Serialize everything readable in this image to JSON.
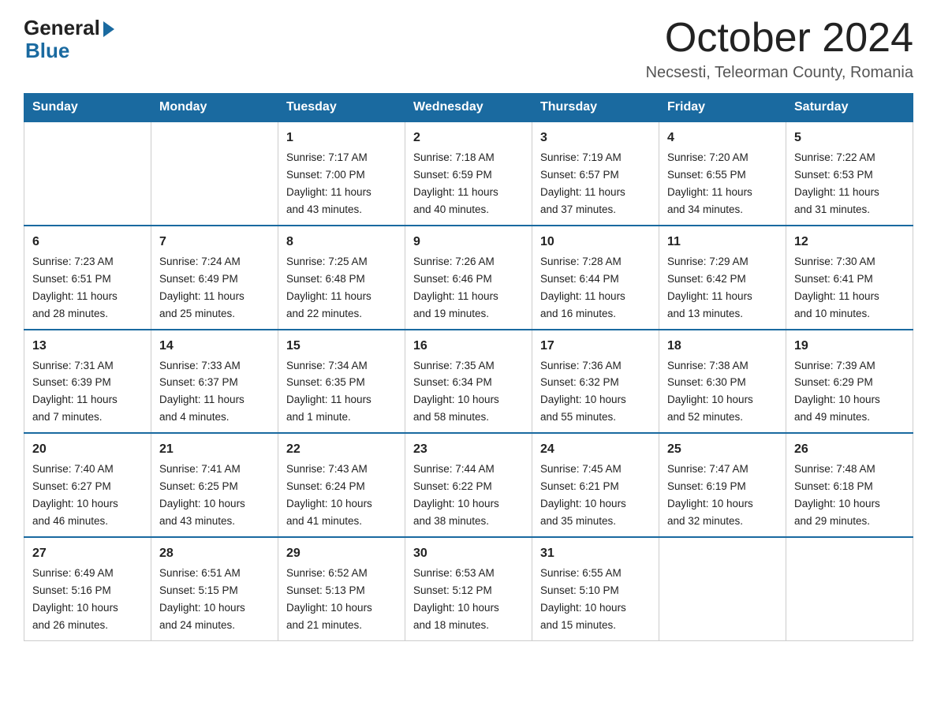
{
  "logo": {
    "general": "General",
    "blue": "Blue"
  },
  "title": "October 2024",
  "subtitle": "Necsesti, Teleorman County, Romania",
  "days_header": [
    "Sunday",
    "Monday",
    "Tuesday",
    "Wednesday",
    "Thursday",
    "Friday",
    "Saturday"
  ],
  "weeks": [
    [
      {
        "day": "",
        "info": ""
      },
      {
        "day": "",
        "info": ""
      },
      {
        "day": "1",
        "info": "Sunrise: 7:17 AM\nSunset: 7:00 PM\nDaylight: 11 hours\nand 43 minutes."
      },
      {
        "day": "2",
        "info": "Sunrise: 7:18 AM\nSunset: 6:59 PM\nDaylight: 11 hours\nand 40 minutes."
      },
      {
        "day": "3",
        "info": "Sunrise: 7:19 AM\nSunset: 6:57 PM\nDaylight: 11 hours\nand 37 minutes."
      },
      {
        "day": "4",
        "info": "Sunrise: 7:20 AM\nSunset: 6:55 PM\nDaylight: 11 hours\nand 34 minutes."
      },
      {
        "day": "5",
        "info": "Sunrise: 7:22 AM\nSunset: 6:53 PM\nDaylight: 11 hours\nand 31 minutes."
      }
    ],
    [
      {
        "day": "6",
        "info": "Sunrise: 7:23 AM\nSunset: 6:51 PM\nDaylight: 11 hours\nand 28 minutes."
      },
      {
        "day": "7",
        "info": "Sunrise: 7:24 AM\nSunset: 6:49 PM\nDaylight: 11 hours\nand 25 minutes."
      },
      {
        "day": "8",
        "info": "Sunrise: 7:25 AM\nSunset: 6:48 PM\nDaylight: 11 hours\nand 22 minutes."
      },
      {
        "day": "9",
        "info": "Sunrise: 7:26 AM\nSunset: 6:46 PM\nDaylight: 11 hours\nand 19 minutes."
      },
      {
        "day": "10",
        "info": "Sunrise: 7:28 AM\nSunset: 6:44 PM\nDaylight: 11 hours\nand 16 minutes."
      },
      {
        "day": "11",
        "info": "Sunrise: 7:29 AM\nSunset: 6:42 PM\nDaylight: 11 hours\nand 13 minutes."
      },
      {
        "day": "12",
        "info": "Sunrise: 7:30 AM\nSunset: 6:41 PM\nDaylight: 11 hours\nand 10 minutes."
      }
    ],
    [
      {
        "day": "13",
        "info": "Sunrise: 7:31 AM\nSunset: 6:39 PM\nDaylight: 11 hours\nand 7 minutes."
      },
      {
        "day": "14",
        "info": "Sunrise: 7:33 AM\nSunset: 6:37 PM\nDaylight: 11 hours\nand 4 minutes."
      },
      {
        "day": "15",
        "info": "Sunrise: 7:34 AM\nSunset: 6:35 PM\nDaylight: 11 hours\nand 1 minute."
      },
      {
        "day": "16",
        "info": "Sunrise: 7:35 AM\nSunset: 6:34 PM\nDaylight: 10 hours\nand 58 minutes."
      },
      {
        "day": "17",
        "info": "Sunrise: 7:36 AM\nSunset: 6:32 PM\nDaylight: 10 hours\nand 55 minutes."
      },
      {
        "day": "18",
        "info": "Sunrise: 7:38 AM\nSunset: 6:30 PM\nDaylight: 10 hours\nand 52 minutes."
      },
      {
        "day": "19",
        "info": "Sunrise: 7:39 AM\nSunset: 6:29 PM\nDaylight: 10 hours\nand 49 minutes."
      }
    ],
    [
      {
        "day": "20",
        "info": "Sunrise: 7:40 AM\nSunset: 6:27 PM\nDaylight: 10 hours\nand 46 minutes."
      },
      {
        "day": "21",
        "info": "Sunrise: 7:41 AM\nSunset: 6:25 PM\nDaylight: 10 hours\nand 43 minutes."
      },
      {
        "day": "22",
        "info": "Sunrise: 7:43 AM\nSunset: 6:24 PM\nDaylight: 10 hours\nand 41 minutes."
      },
      {
        "day": "23",
        "info": "Sunrise: 7:44 AM\nSunset: 6:22 PM\nDaylight: 10 hours\nand 38 minutes."
      },
      {
        "day": "24",
        "info": "Sunrise: 7:45 AM\nSunset: 6:21 PM\nDaylight: 10 hours\nand 35 minutes."
      },
      {
        "day": "25",
        "info": "Sunrise: 7:47 AM\nSunset: 6:19 PM\nDaylight: 10 hours\nand 32 minutes."
      },
      {
        "day": "26",
        "info": "Sunrise: 7:48 AM\nSunset: 6:18 PM\nDaylight: 10 hours\nand 29 minutes."
      }
    ],
    [
      {
        "day": "27",
        "info": "Sunrise: 6:49 AM\nSunset: 5:16 PM\nDaylight: 10 hours\nand 26 minutes."
      },
      {
        "day": "28",
        "info": "Sunrise: 6:51 AM\nSunset: 5:15 PM\nDaylight: 10 hours\nand 24 minutes."
      },
      {
        "day": "29",
        "info": "Sunrise: 6:52 AM\nSunset: 5:13 PM\nDaylight: 10 hours\nand 21 minutes."
      },
      {
        "day": "30",
        "info": "Sunrise: 6:53 AM\nSunset: 5:12 PM\nDaylight: 10 hours\nand 18 minutes."
      },
      {
        "day": "31",
        "info": "Sunrise: 6:55 AM\nSunset: 5:10 PM\nDaylight: 10 hours\nand 15 minutes."
      },
      {
        "day": "",
        "info": ""
      },
      {
        "day": "",
        "info": ""
      }
    ]
  ]
}
